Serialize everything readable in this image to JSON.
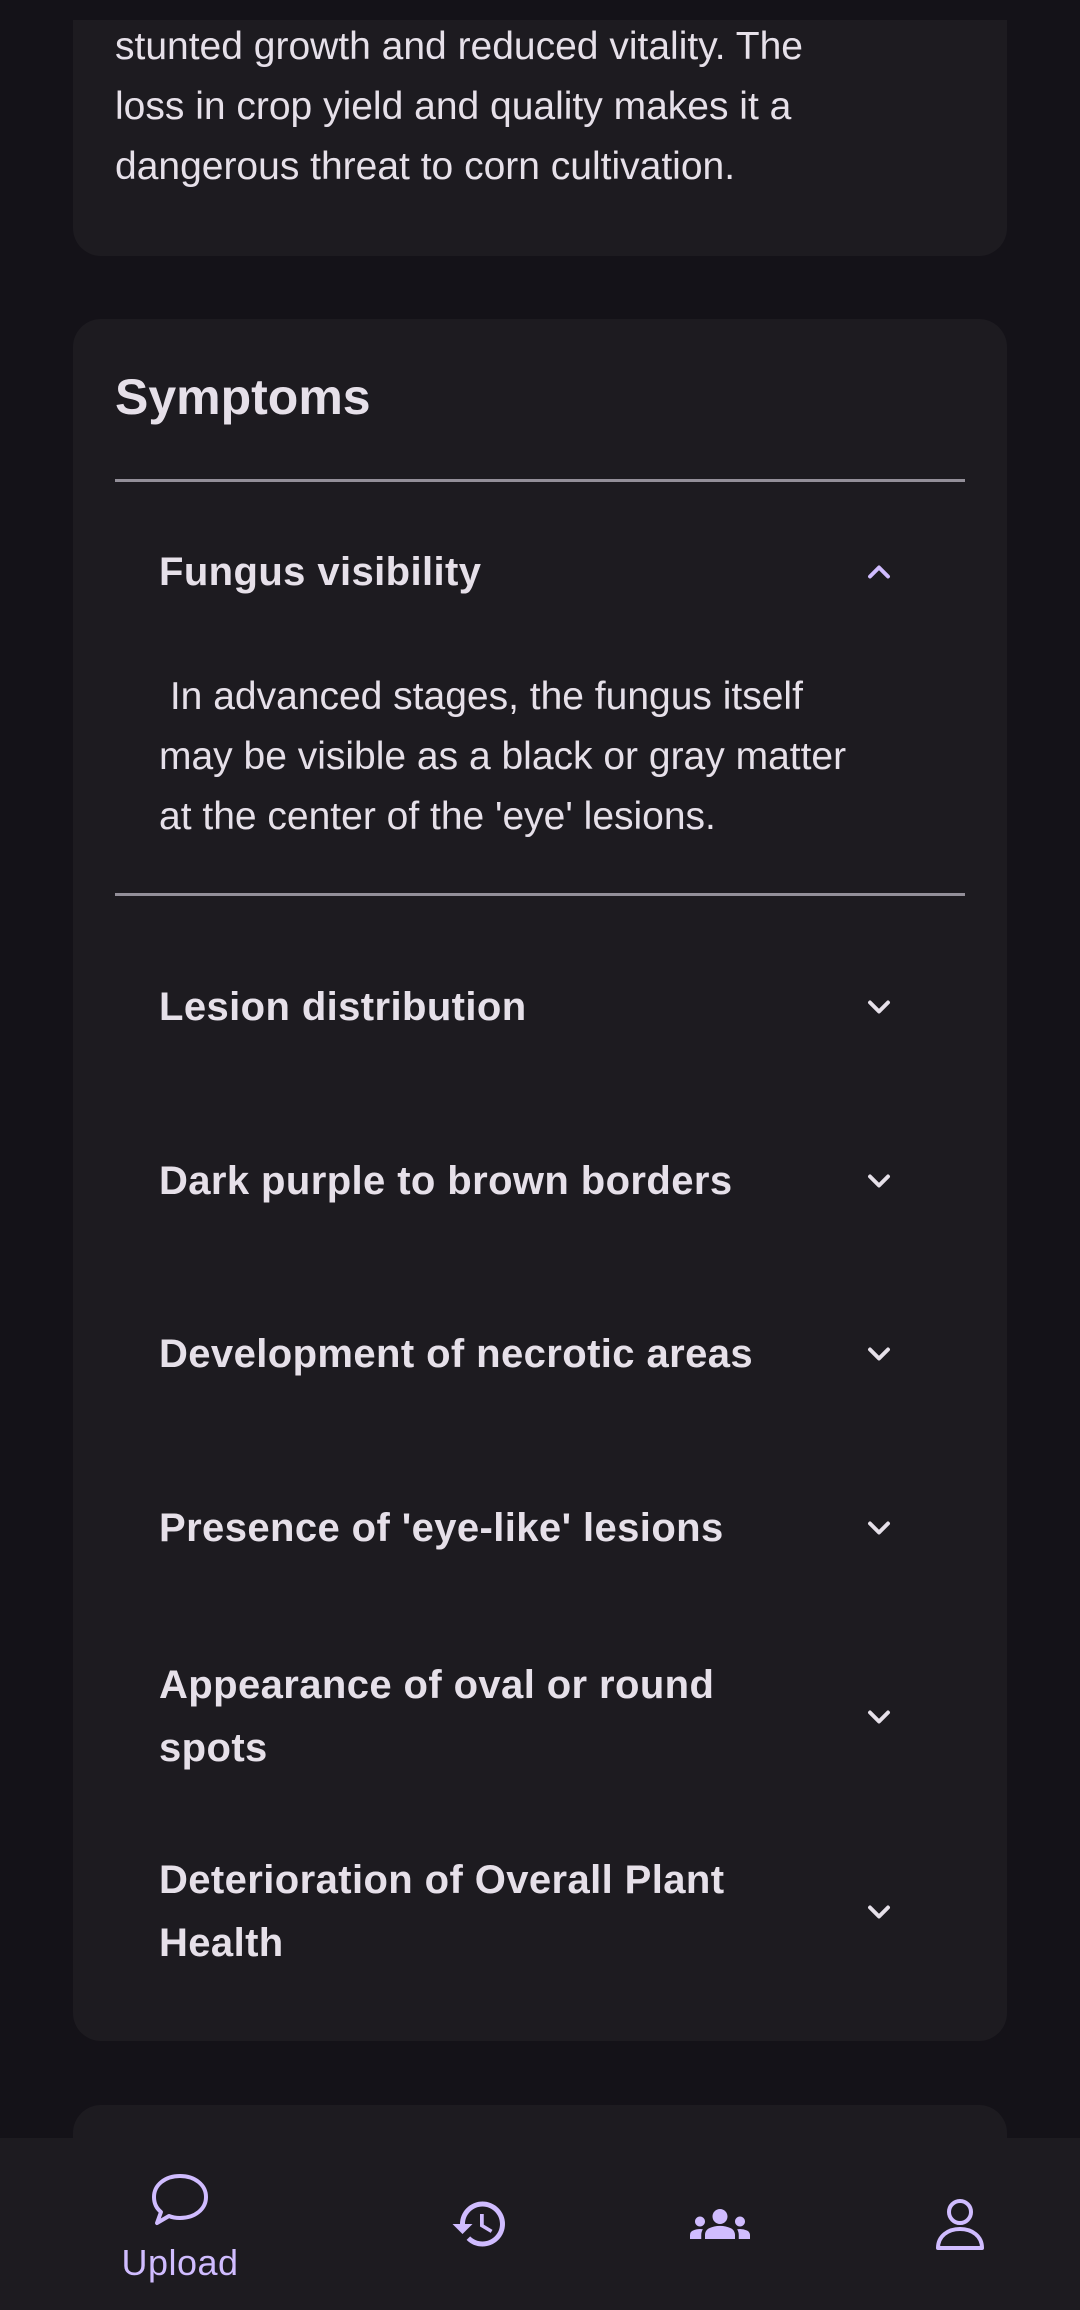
{
  "overview": {
    "text": "stunted growth and reduced vitality. The\nloss in crop yield and quality makes it a\ndangerous threat to corn cultivation."
  },
  "symptoms": {
    "title": "Symptoms",
    "expanded": {
      "label": "Fungus visibility",
      "body": " In advanced stages, the fungus itself\nmay be visible as a black or gray matter\nat the center of the 'eye' lesions."
    },
    "items": [
      {
        "label": "Lesion distribution"
      },
      {
        "label": "Dark purple to brown borders"
      },
      {
        "label": "Development of necrotic areas"
      },
      {
        "label": "Presence of 'eye-like' lesions"
      },
      {
        "label": "Appearance of oval or round spots"
      },
      {
        "label": "Deterioration of Overall Plant Health"
      }
    ]
  },
  "nav": {
    "upload_label": "Upload",
    "icons": [
      "chat-bubble-icon",
      "history-icon",
      "community-icon",
      "profile-icon"
    ]
  },
  "colors": {
    "background": "#141218",
    "card": "#1d1b20",
    "accent": "#d0bcff",
    "text": "#e6e0e9",
    "divider": "#938f99"
  }
}
